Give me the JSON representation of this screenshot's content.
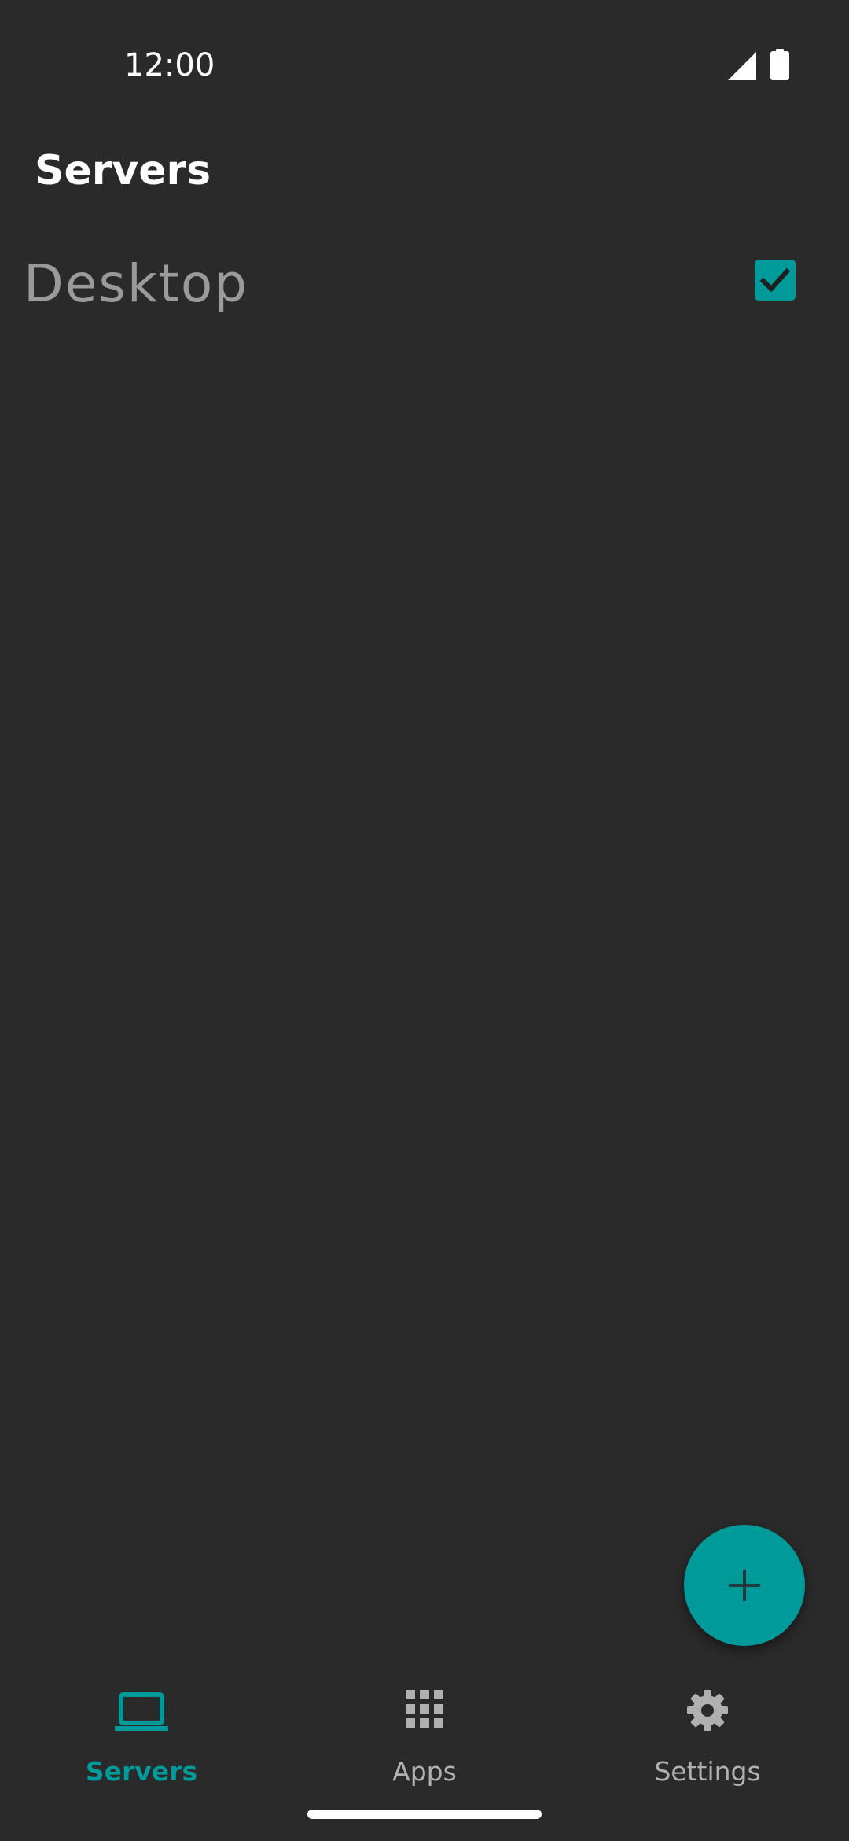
{
  "status_bar": {
    "time": "12:00",
    "signal_icon": "cell-signal-icon",
    "battery_icon": "battery-icon"
  },
  "app_bar": {
    "title": "Servers"
  },
  "servers": [
    {
      "name": "Desktop",
      "selected": true
    }
  ],
  "fab": {
    "icon": "plus-icon"
  },
  "bottom_nav": {
    "items": [
      {
        "label": "Servers",
        "icon": "laptop-icon",
        "active": true
      },
      {
        "label": "Apps",
        "icon": "grid-icon",
        "active": false
      },
      {
        "label": "Settings",
        "icon": "gear-icon",
        "active": false
      }
    ]
  },
  "colors": {
    "background": "#2a2a2a",
    "accent": "#009a9a",
    "text_primary": "#ffffff",
    "text_secondary": "#9a9a9a",
    "nav_inactive": "#b0b0b0"
  }
}
